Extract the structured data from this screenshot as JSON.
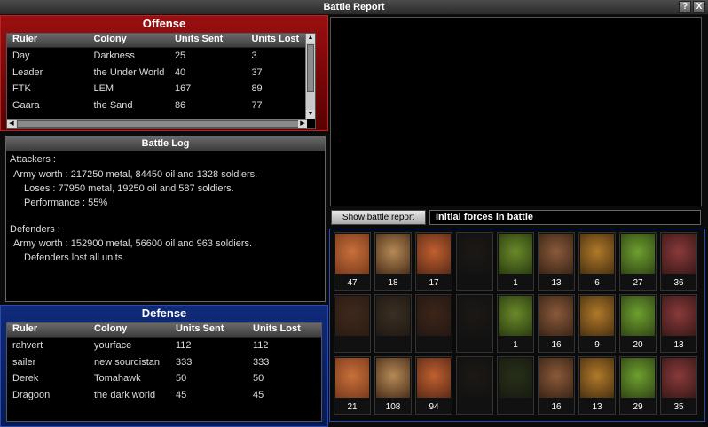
{
  "window": {
    "title": "Battle Report",
    "help_label": "?",
    "close_label": "X"
  },
  "offense": {
    "title": "Offense",
    "columns": [
      "Ruler",
      "Colony",
      "Units Sent",
      "Units Lost"
    ],
    "rows": [
      [
        "Day",
        "Darkness",
        "25",
        "3"
      ],
      [
        "Leader",
        "the Under World",
        "40",
        "37"
      ],
      [
        "FTK",
        "LEM",
        "167",
        "89"
      ],
      [
        "Gaara",
        "the Sand",
        "86",
        "77"
      ]
    ]
  },
  "battle_log": {
    "title": "Battle Log",
    "lines": [
      "Attackers :",
      "Army worth : 217250 metal, 84450 oil and 1328 soldiers.",
      "Loses : 77950 metal, 19250 oil and 587 soldiers.",
      "Performance : 55%",
      "",
      "Defenders :",
      "Army worth : 152900 metal, 56600 oil and 963 soldiers.",
      "Defenders lost all units."
    ]
  },
  "defense": {
    "title": "Defense",
    "columns": [
      "Ruler",
      "Colony",
      "Units Sent",
      "Units Lost"
    ],
    "rows": [
      [
        "rahvert",
        "yourface",
        "112",
        "112"
      ],
      [
        "sailer",
        "new sourdistan",
        "333",
        "333"
      ],
      [
        "Derek",
        "Tomahawk",
        "50",
        "50"
      ],
      [
        "Dragoon",
        "the dark world",
        "45",
        "45"
      ]
    ]
  },
  "controls": {
    "show_report_label": "Show battle report",
    "forces_title": "Initial forces in battle"
  },
  "units": [
    [
      "47",
      "18",
      "17",
      "",
      "1",
      "13",
      "6",
      "27",
      "36"
    ],
    [
      "",
      "",
      "",
      "",
      "1",
      "16",
      "9",
      "20",
      "13"
    ],
    [
      "21",
      "108",
      "94",
      "",
      "",
      "16",
      "13",
      "29",
      "35"
    ]
  ],
  "colors": {
    "offense": "#9b0f0f",
    "defense": "#0f2a7a",
    "background": "#000000"
  }
}
